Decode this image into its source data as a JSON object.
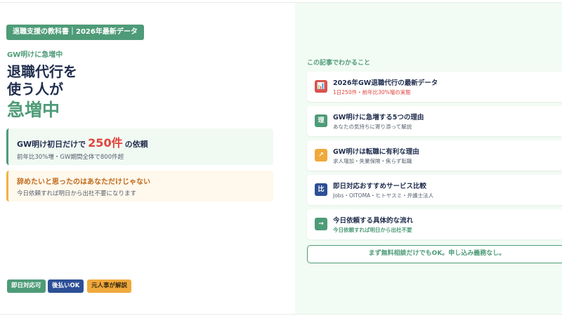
{
  "brand_badge": "退職支援の教科書｜2026年最新データ",
  "kicker": "GW明けに急増中",
  "headline": {
    "line1": "退職代行を",
    "line2": "使う人が",
    "accent": "急増中"
  },
  "stat_card": {
    "prefix": "GW明け初日だけで",
    "highlight": "250件",
    "suffix": "の依頼",
    "sub": "前年比30%増・GW期間全体で800件超"
  },
  "quote_card": {
    "title": "辞めたいと思ったのはあなただけじゃない",
    "sub": "今日依頼すれば明日から出社不要になります"
  },
  "tags": [
    "即日対応可",
    "後払いOK",
    "元人事が解説"
  ],
  "toc": {
    "label": "この記事でわかること",
    "items": [
      {
        "icon": "📊",
        "icon_name": "chart-icon",
        "color": "#d9534f",
        "title": "2026年GW退職代行の最新データ",
        "sub": "1日250件・前年比30%増の実態",
        "sub_style": "red"
      },
      {
        "icon": "理",
        "icon_name": "reason-icon",
        "color": "#4e9b78",
        "title": "GW明けに急増する5つの理由",
        "sub": "あなたの気持ちに寄り添って解説",
        "sub_style": "gray"
      },
      {
        "icon": "↗",
        "icon_name": "trend-up-icon",
        "color": "#f0a93c",
        "title": "GW明けは転職に有利な理由",
        "sub": "求人増加・失業保険・焦らず転職",
        "sub_style": "gray"
      },
      {
        "icon": "比",
        "icon_name": "compare-icon",
        "color": "#2d4f96",
        "title": "即日対応おすすめサービス比較",
        "sub": "Jobs・OITOMA・ヒトヤスミ・弁護士法人",
        "sub_style": "gray"
      },
      {
        "icon": "→",
        "icon_name": "arrow-right-icon",
        "color": "#4e9b78",
        "title": "今日依頼する具体的な流れ",
        "sub": "今日依頼すれば明日から出社不要",
        "sub_style": "green"
      }
    ]
  },
  "cta": "まず無料相談だけでもOK。申し込み義務なし。"
}
